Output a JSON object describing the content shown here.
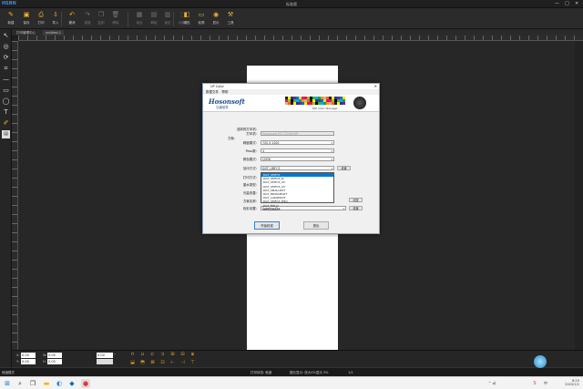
{
  "app": {
    "logo": "HSBN",
    "title": "标准版"
  },
  "window_controls": {
    "min": "—",
    "max": "□",
    "close": "✕"
  },
  "toolbar": [
    {
      "label": "新建",
      "icon": "new-icon",
      "glyph": "✎"
    },
    {
      "label": "保存",
      "icon": "save-icon",
      "glyph": "▣"
    },
    {
      "label": "打印",
      "icon": "print-icon",
      "glyph": "⎙"
    },
    {
      "label": "导入",
      "icon": "import-icon",
      "glyph": "⇩"
    },
    {
      "label": "撤消",
      "icon": "undo-icon",
      "glyph": "↶"
    },
    {
      "label": "重做",
      "icon": "redo-icon",
      "glyph": "↷"
    },
    {
      "label": "复制",
      "icon": "copy-icon",
      "glyph": "❐"
    },
    {
      "label": "删除",
      "icon": "delete-icon",
      "glyph": "🗑"
    },
    {
      "label": "组合",
      "icon": "group-icon",
      "glyph": "▦"
    },
    {
      "label": "解组",
      "icon": "ungroup-icon",
      "glyph": "▤"
    },
    {
      "label": "锁定",
      "icon": "lock-icon",
      "glyph": "▥"
    },
    {
      "label": "对象框",
      "icon": "object-frame-icon",
      "glyph": "⬚"
    },
    {
      "label": "填充",
      "icon": "fill-icon",
      "glyph": "◧"
    },
    {
      "label": "轮廓",
      "icon": "outline-icon",
      "glyph": "▭"
    },
    {
      "label": "显示",
      "icon": "view-icon",
      "glyph": "◉"
    },
    {
      "label": "工具",
      "icon": "tools-icon",
      "glyph": "⚒"
    }
  ],
  "tabs": [
    "打印管理中心",
    "untitled-1"
  ],
  "left_tools": [
    "pointer-icon",
    "node-icon",
    "rotate-icon",
    "crop-icon",
    "line-icon",
    "rect-icon",
    "ellipse-icon",
    "text-icon",
    "pen-icon",
    "barcode-icon"
  ],
  "left_glyphs": [
    "↖",
    "◎",
    "⟳",
    "⌗",
    "—",
    "▭",
    "◯",
    "T",
    "✐",
    "▤"
  ],
  "dialog": {
    "title": "UP Color",
    "menu": [
      "数据文件",
      "帮助"
    ],
    "brand": "Hosonsoft",
    "brand_sub": "汉森软件",
    "product": "RIP Color Manager",
    "labels": {
      "select_printer": "选择的打印机:",
      "printer": "打印机:",
      "scheme": "方案:",
      "resolution": "精度模式:",
      "pass": "Pass数:",
      "color_mode": "颜色模式:",
      "print_mode": "加印方式:",
      "print_quality": "打印方式:",
      "ink_limit": "墨水类型:",
      "correction": "光量改善:",
      "icc": "方案名称:",
      "media": "纸张名称:",
      "output": "色彩设置:"
    },
    "fields": {
      "printer": "Hosonsoft-HS-7200H-RIP",
      "resolution": "720 X 1200",
      "pass": "4",
      "color_mode": "CMYK",
      "print_mode": "DGT_UMFC5",
      "output": "Extreme Pro"
    },
    "dropdown": [
      "DGT_UMFC5",
      "DGT_UMFC5_M",
      "DGT_UMFC5_UV",
      "DGT_UMFC5_UV",
      "DGT_SMALLDOT",
      "DGT_MIDDLEDOT",
      "DGT_LARGEDOT",
      "DGT_UMFC5_M5Q",
      "DGT_MM-Q",
      "DGT_LSMA2"
    ],
    "dropdown_selected": 0,
    "set_label": "设置",
    "browse_label": "浏览",
    "set2_label": "设置",
    "ok": "开始校准",
    "cancel": "退出"
  },
  "bottom": {
    "x": "0.00",
    "y": "0.00",
    "w": "0.00",
    "h": "0.00",
    "r": "0.00",
    "x_lbl": "X:",
    "y_lbl": "Y:",
    "w_lbl": "W:",
    "h_lbl": "H:",
    "r_lbl": "°"
  },
  "status": {
    "left": "就绪模式",
    "mid": "打印状态: 就绪",
    "right": "图元显示: 放大0%显示 3%",
    "page": "1/1"
  },
  "taskbar": {
    "time": "8:15",
    "date": "2022/1/1",
    "ime": "S",
    "lang": "中"
  }
}
